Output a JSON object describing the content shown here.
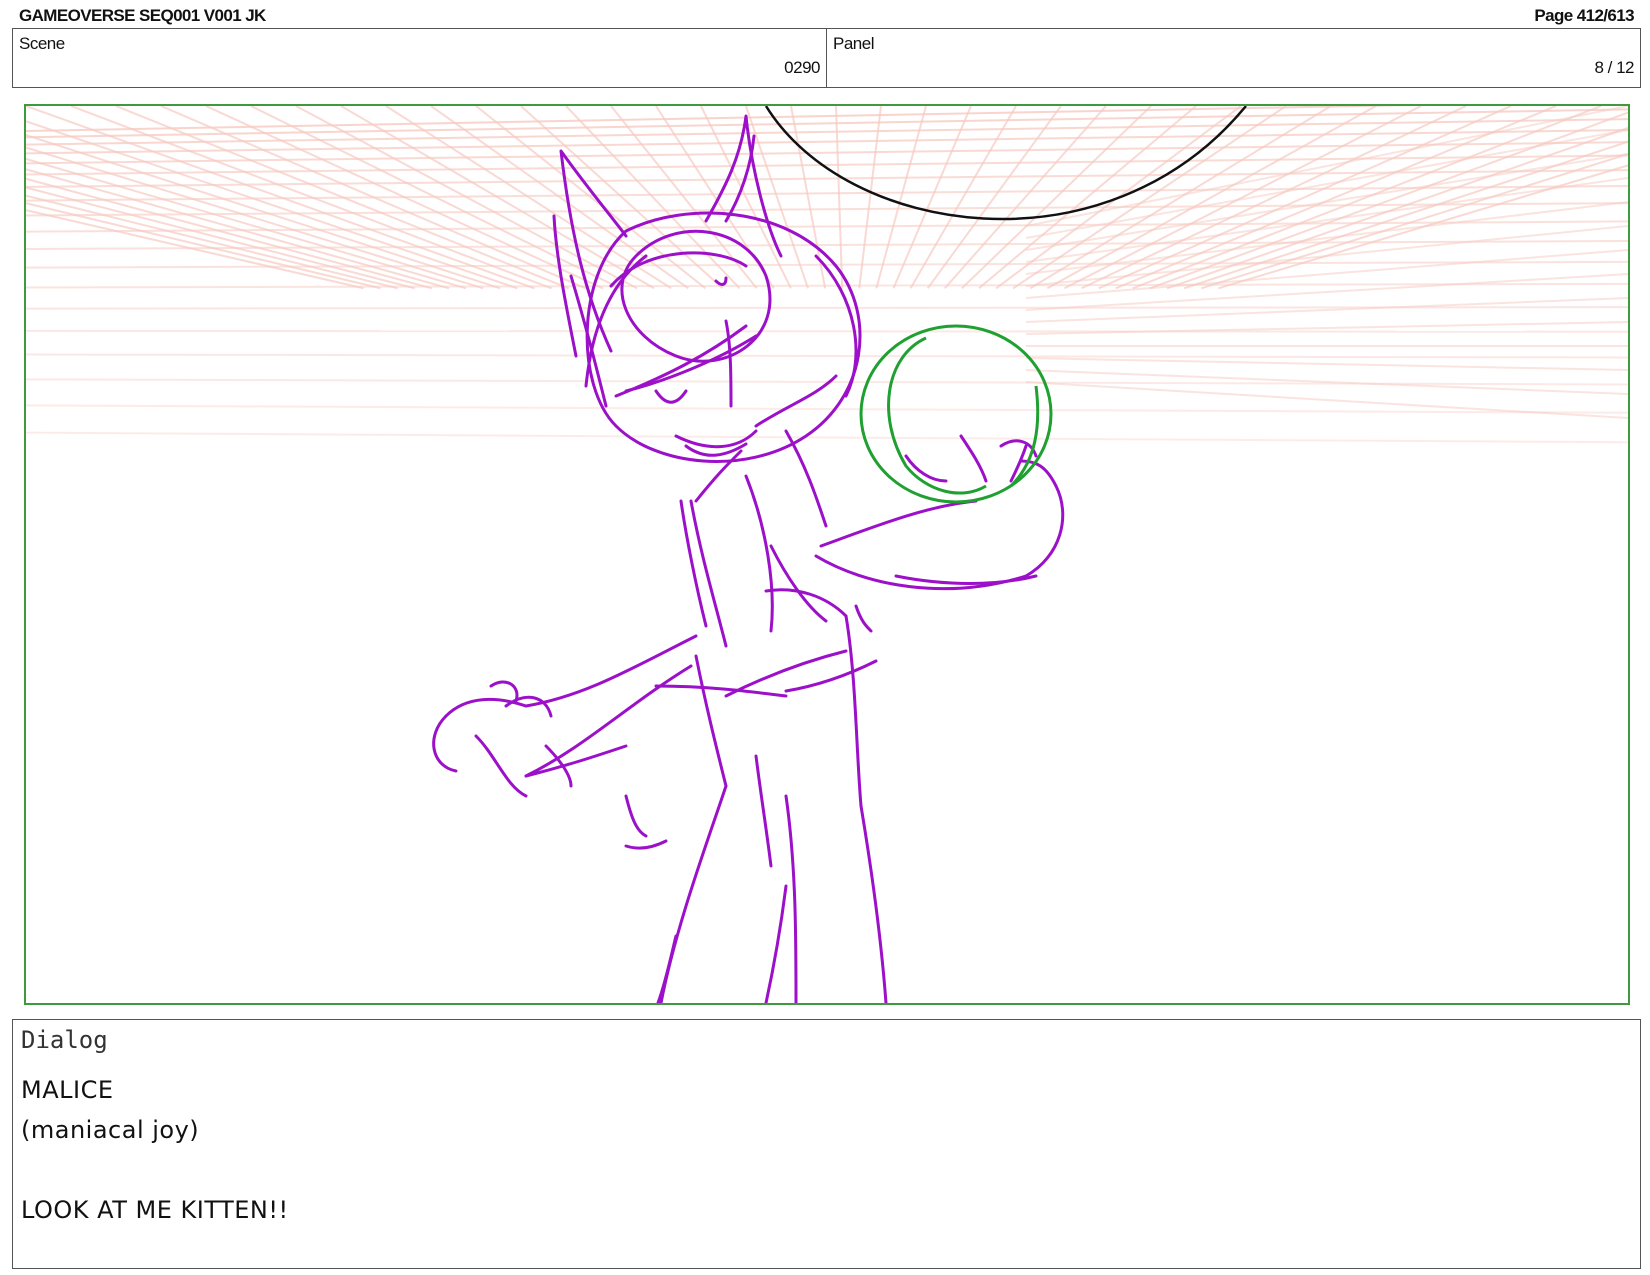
{
  "header": {
    "title": "GAMEOVERSE SEQ001 V001 JK",
    "page": "Page 412/613"
  },
  "info": {
    "scene_label": "Scene",
    "scene_value": "0290",
    "panel_label": "Panel",
    "panel_value": "8 / 12"
  },
  "dialog": {
    "label": "Dialog",
    "lines": [
      "MALICE",
      "(maniacal joy)",
      "",
      "LOOK AT ME KITTEN!!"
    ]
  },
  "colors": {
    "sketch": "#9b10c8",
    "ball": "#1fa031",
    "grid": "#f6c9c0",
    "panel_border": "#3f9a3f"
  }
}
